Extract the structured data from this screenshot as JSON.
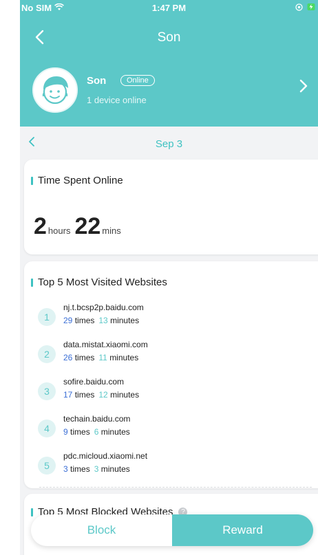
{
  "status_bar": {
    "carrier": "No SIM",
    "time": "1:47 PM"
  },
  "nav": {
    "title": "Son"
  },
  "profile": {
    "name": "Son",
    "status_badge": "Online",
    "devices_text": "1 device online"
  },
  "date_nav": {
    "date": "Sep 3"
  },
  "time_spent": {
    "title": "Time Spent Online",
    "hours": "2",
    "hours_unit": "hours",
    "minutes": "22",
    "minutes_unit": "mins"
  },
  "top_visited": {
    "title": "Top 5 Most Visited Websites",
    "items": [
      {
        "rank": "1",
        "domain": "nj.t.bcsp2p.baidu.com",
        "count": "29",
        "count_unit": "times",
        "minutes": "13",
        "minutes_unit": "minutes"
      },
      {
        "rank": "2",
        "domain": "data.mistat.xiaomi.com",
        "count": "26",
        "count_unit": "times",
        "minutes": "11",
        "minutes_unit": "minutes"
      },
      {
        "rank": "3",
        "domain": "sofire.baidu.com",
        "count": "17",
        "count_unit": "times",
        "minutes": "12",
        "minutes_unit": "minutes"
      },
      {
        "rank": "4",
        "domain": "techain.baidu.com",
        "count": "9",
        "count_unit": "times",
        "minutes": "6",
        "minutes_unit": "minutes"
      },
      {
        "rank": "5",
        "domain": "pdc.micloud.xiaomi.net",
        "count": "3",
        "count_unit": "times",
        "minutes": "3",
        "minutes_unit": "minutes"
      }
    ]
  },
  "top_blocked": {
    "title": "Top 5 Most Blocked Websites",
    "help_glyph": "?"
  },
  "segment": {
    "block_label": "Block",
    "reward_label": "Reward"
  },
  "icons": {
    "wifi": "wifi-icon",
    "back": "chevron-left-icon",
    "forward": "chevron-right-icon",
    "location": "location-icon",
    "battery": "battery-icon",
    "avatar": "kid-face-icon",
    "help": "help-icon"
  },
  "colors": {
    "brand": "#5cc8c8",
    "accent_text": "#3ec2c2",
    "count_blue": "#3b6fd6",
    "background": "#f2f3f5",
    "battery_green": "#4cd964"
  }
}
